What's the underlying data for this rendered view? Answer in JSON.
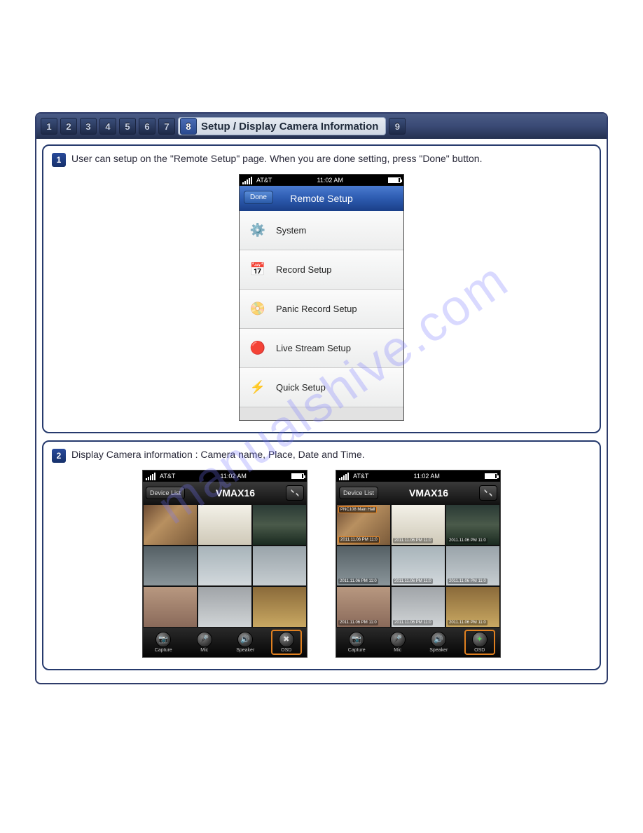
{
  "watermark": "manualshive.com",
  "tabs": {
    "nums": [
      "1",
      "2",
      "3",
      "4",
      "5",
      "6",
      "7"
    ],
    "active_num": "8",
    "active_title": "Setup / Display Camera Information",
    "trailing": [
      "9"
    ]
  },
  "step1": {
    "num": "1",
    "text": "User can setup on the \"Remote Setup\" page. When you are done setting, press \"Done\" button.",
    "phone": {
      "carrier": "AT&T",
      "time": "11:02 AM",
      "nav_title": "Remote Setup",
      "done_label": "Done",
      "menu": [
        {
          "icon": "⚙️",
          "label": "System"
        },
        {
          "icon": "📅",
          "label": "Record Setup"
        },
        {
          "icon": "📀",
          "label": "Panic Record Setup"
        },
        {
          "icon": "🔴",
          "label": "Live Stream Setup"
        },
        {
          "icon": "⚡",
          "label": "Quick Setup"
        }
      ]
    }
  },
  "step2": {
    "num": "2",
    "text": "Display Camera information : Camera name, Place, Date and Time.",
    "phone": {
      "carrier": "AT&T",
      "time": "11:02 AM",
      "title": "VMAX16",
      "device_list": "Device List",
      "buttons": {
        "capture": "Capture",
        "mic": "Mic",
        "speaker": "Speaker",
        "osd": "OSD"
      },
      "osd_name": "PNC108 Main Hall",
      "osd_time": "2011.11.06 PM 11:0",
      "timestamp": "2011.11.06 PM 11:0"
    }
  }
}
